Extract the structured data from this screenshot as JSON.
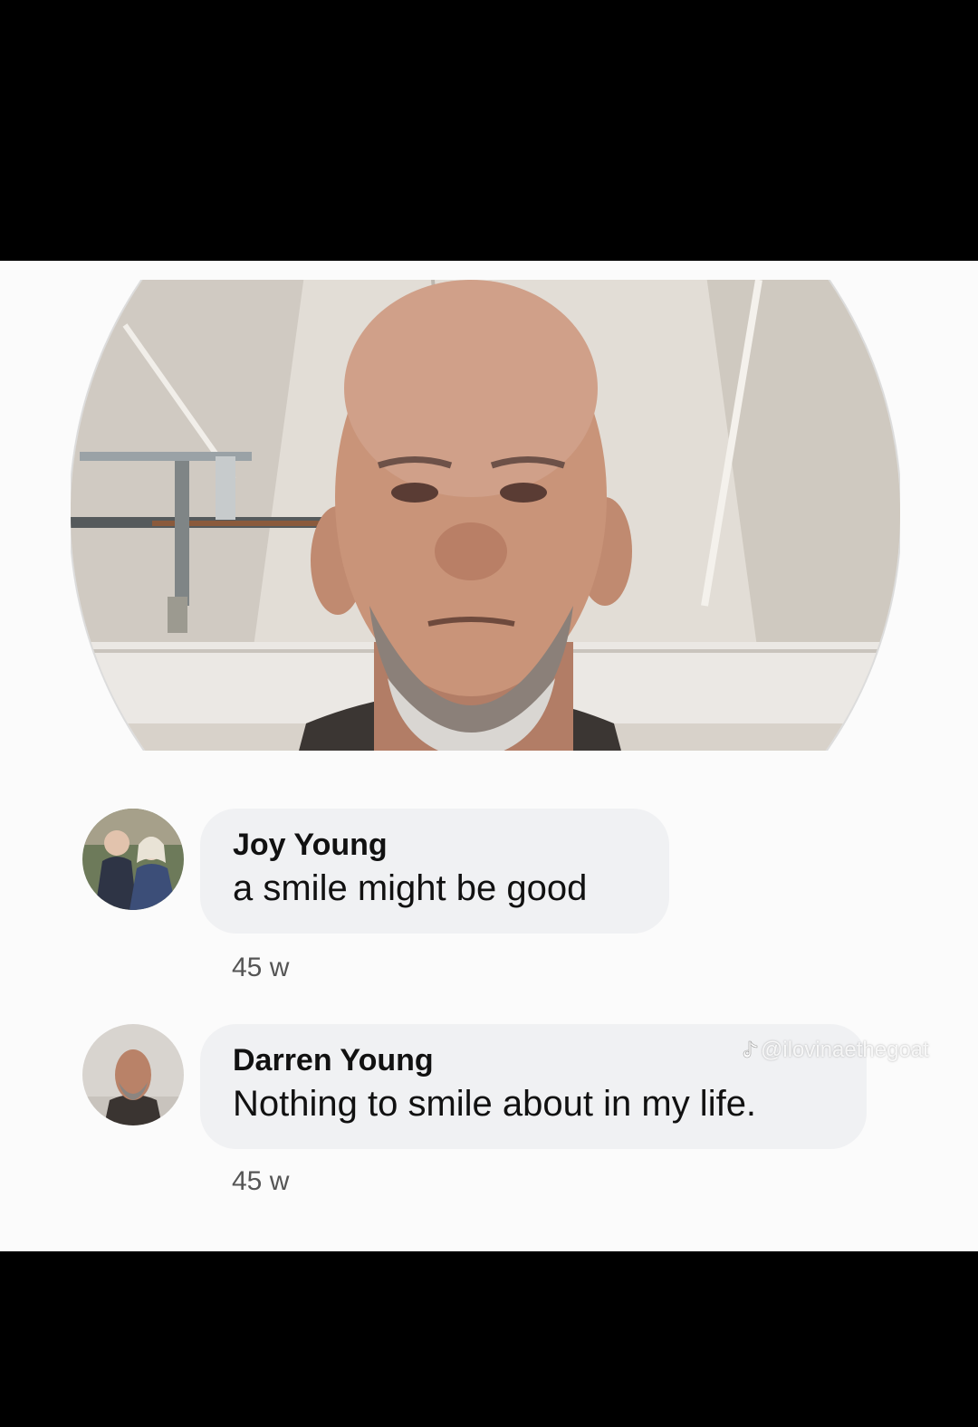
{
  "comments": [
    {
      "author": "Joy Young",
      "text": "a smile might be good",
      "timestamp": "45 w",
      "avatar_icon": "couple-photo-avatar"
    },
    {
      "author": "Darren Young",
      "text": "Nothing to smile about in my life.",
      "timestamp": "45 w",
      "avatar_icon": "man-photo-avatar"
    }
  ],
  "watermark": {
    "handle": "@ilovinaethegoat",
    "icon": "tiktok-note-icon"
  },
  "colors": {
    "background_bars": "#000000",
    "panel": "#fbfbfb",
    "bubble": "#f0f1f3",
    "text": "#111111",
    "meta_text": "#555555"
  }
}
